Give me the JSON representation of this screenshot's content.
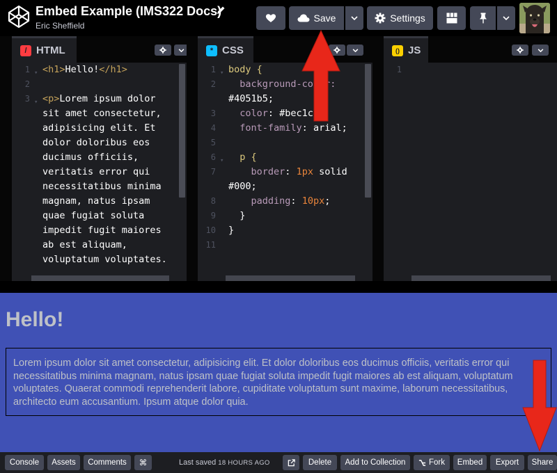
{
  "header": {
    "title": "Embed Example (IMS322 Docs)",
    "author": "Eric Sheffield",
    "save_label": "Save",
    "settings_label": "Settings"
  },
  "editors": {
    "html": {
      "label": "HTML",
      "badge": "/",
      "line_numbers": [
        "1",
        "2",
        "3"
      ],
      "lines": [
        "<h1>Hello!</h1>",
        "",
        "<p>Lorem ipsum dolor",
        "sit amet consectetur,",
        "adipisicing elit. Et",
        "dolor doloribus eos",
        "ducimus officiis,",
        "veritatis error qui",
        "necessitatibus minima",
        "magnam, natus ipsam",
        "quae fugiat soluta",
        "impedit fugit maiores",
        "ab est aliquam,",
        "voluptatum voluptates."
      ]
    },
    "css": {
      "label": "CSS",
      "badge": "*",
      "line_numbers": [
        "1",
        "2",
        "",
        "3",
        "4",
        "5",
        "6",
        "7",
        "",
        "8",
        "9",
        "10",
        "11"
      ],
      "lines": [
        "body {",
        "  background-color:",
        "#4051b5;",
        "  color: #bec1c7;",
        "  font-family: arial;",
        "",
        "  p {",
        "    border: 1px solid",
        "#000;",
        "    padding: 10px;",
        "  }",
        "}",
        ""
      ]
    },
    "js": {
      "label": "JS",
      "badge": "()",
      "line_numbers": [
        "1"
      ]
    }
  },
  "preview": {
    "heading": "Hello!",
    "paragraph": "Lorem ipsum dolor sit amet consectetur, adipisicing elit. Et dolor doloribus eos ducimus officiis, veritatis error qui necessitatibus minima magnam, natus ipsam quae fugiat soluta impedit fugit maiores ab est aliquam, voluptatum voluptates. Quaerat commodi reprehenderit labore, cupiditate voluptatum sunt maxime, laborum necessitatibus, architecto eum accusantium. Ipsum atque dolor quia."
  },
  "footer": {
    "console": "Console",
    "assets": "Assets",
    "comments": "Comments",
    "shortcuts": "⌘",
    "last_saved_label": "Last saved",
    "last_saved_when": "18 HOURS AGO",
    "delete": "Delete",
    "add_to_collection": "Add to Collection",
    "fork": "Fork",
    "embed": "Embed",
    "export": "Export",
    "share": "Share"
  },
  "colors": {
    "preview_background": "#4051b5",
    "preview_text": "#bec1c7",
    "annotation_arrow": "#e8271a",
    "button": "#444857"
  },
  "icons": [
    "codepen-logo-icon",
    "pencil-icon",
    "heart-icon",
    "cloud-icon",
    "chevron-down-icon",
    "gear-icon",
    "layout-icon",
    "pin-icon",
    "external-link-icon",
    "fork-icon",
    "red-arrow-up-icon",
    "red-arrow-down-icon"
  ]
}
